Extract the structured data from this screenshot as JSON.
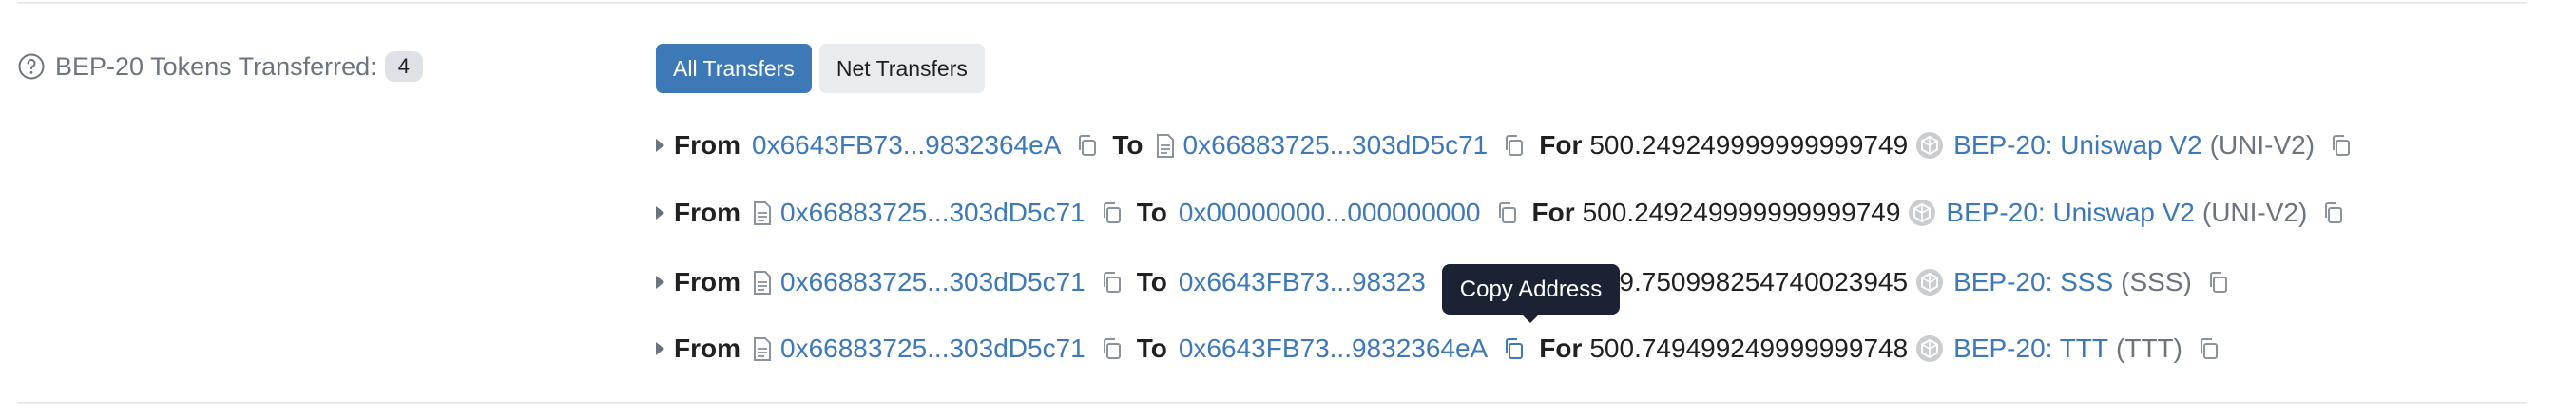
{
  "section": {
    "label": "BEP-20 Tokens Transferred:",
    "count": "4",
    "help_icon": "question-circle-icon"
  },
  "tabs": {
    "all_transfers": "All Transfers",
    "net_transfers": "Net Transfers"
  },
  "transfers": [
    {
      "from_label": "From",
      "from_address": "0x6643FB73...9832364eA",
      "from_is_contract": false,
      "to_label": "To",
      "to_address": "0x66883725...303dD5c71",
      "to_is_contract": true,
      "for_label": "For",
      "amount": "500.249249999999999749",
      "token_name": "BEP-20: Uniswap V2",
      "token_symbol": "(UNI-V2)"
    },
    {
      "from_label": "From",
      "from_address": "0x66883725...303dD5c71",
      "from_is_contract": true,
      "to_label": "To",
      "to_address": "0x00000000...000000000",
      "to_is_contract": false,
      "for_label": "For",
      "amount": "500.249249999999999749",
      "token_name": "BEP-20: Uniswap V2",
      "token_symbol": "(UNI-V2)"
    },
    {
      "from_label": "From",
      "from_address": "0x66883725...303dD5c71",
      "from_is_contract": true,
      "to_label": "To",
      "to_address": "0x6643FB73...98323",
      "to_is_contract": false,
      "amount_partial": "99.750998254740023945",
      "token_name": "BEP-20: SSS",
      "token_symbol": "(SSS)"
    },
    {
      "from_label": "From",
      "from_address": "0x66883725...303dD5c71",
      "from_is_contract": true,
      "to_label": "To",
      "to_address": "0x6643FB73...9832364eA",
      "to_is_contract": false,
      "for_label": "For",
      "amount": "500.749499249999999748",
      "token_name": "BEP-20: TTT",
      "token_symbol": "(TTT)"
    }
  ],
  "tooltip": {
    "text": "Copy Address"
  },
  "colors": {
    "link": "#3e79b7",
    "active_tab": "#3e79b7",
    "inactive_tab": "#e9ecef",
    "tooltip_bg": "#1a2233",
    "muted_text": "#6c757d"
  },
  "icons": {
    "expand": "caret-right-icon",
    "contract": "file-document-icon",
    "copy": "copy-icon",
    "token": "token-logo-icon"
  }
}
